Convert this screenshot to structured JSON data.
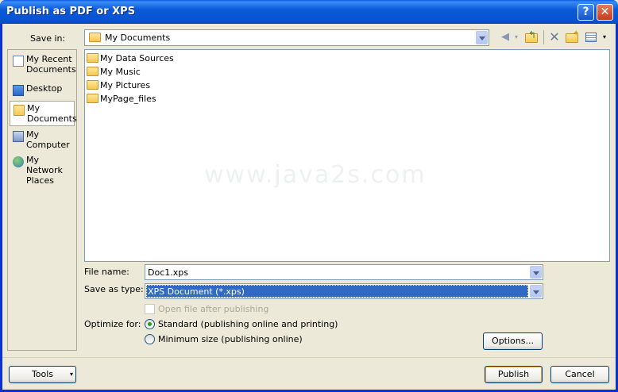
{
  "window": {
    "title": "Publish as PDF or XPS"
  },
  "save_in": {
    "label": "Save in:",
    "value": "My Documents"
  },
  "toolbar": {
    "icons": [
      "back-icon",
      "up-one-level-icon",
      "delete-icon",
      "new-folder-icon",
      "views-icon"
    ]
  },
  "places": [
    {
      "label": "My Recent Documents",
      "icon": "recent-documents-icon",
      "selected": false
    },
    {
      "label": "Desktop",
      "icon": "desktop-icon",
      "selected": false
    },
    {
      "label": "My Documents",
      "icon": "my-documents-icon",
      "selected": true
    },
    {
      "label": "My Computer",
      "icon": "my-computer-icon",
      "selected": false
    },
    {
      "label": "My Network Places",
      "icon": "network-places-icon",
      "selected": false
    }
  ],
  "files": [
    {
      "name": "My Data Sources",
      "icon": "data-sources-folder-icon"
    },
    {
      "name": "My Music",
      "icon": "music-folder-icon"
    },
    {
      "name": "My Pictures",
      "icon": "pictures-folder-icon"
    },
    {
      "name": "MyPage_files",
      "icon": "folder-icon"
    }
  ],
  "watermark": "www.java2s.com",
  "file_name": {
    "label": "File name:",
    "value": "Doc1.xps"
  },
  "save_as_type": {
    "label": "Save as type:",
    "value": "XPS Document (*.xps)"
  },
  "open_after": {
    "label": "Open file after publishing",
    "checked": false,
    "disabled": true
  },
  "optimize": {
    "label": "Optimize for:",
    "options": [
      {
        "label": "Standard (publishing online and printing)",
        "selected": true
      },
      {
        "label": "Minimum size (publishing online)",
        "selected": false
      }
    ]
  },
  "buttons": {
    "options": "Options...",
    "tools": "Tools",
    "publish": "Publish",
    "cancel": "Cancel"
  },
  "colors": {
    "title_bar": "#0a5bd9",
    "dialog_bg": "#ece9d8",
    "selection": "#316ac5"
  }
}
